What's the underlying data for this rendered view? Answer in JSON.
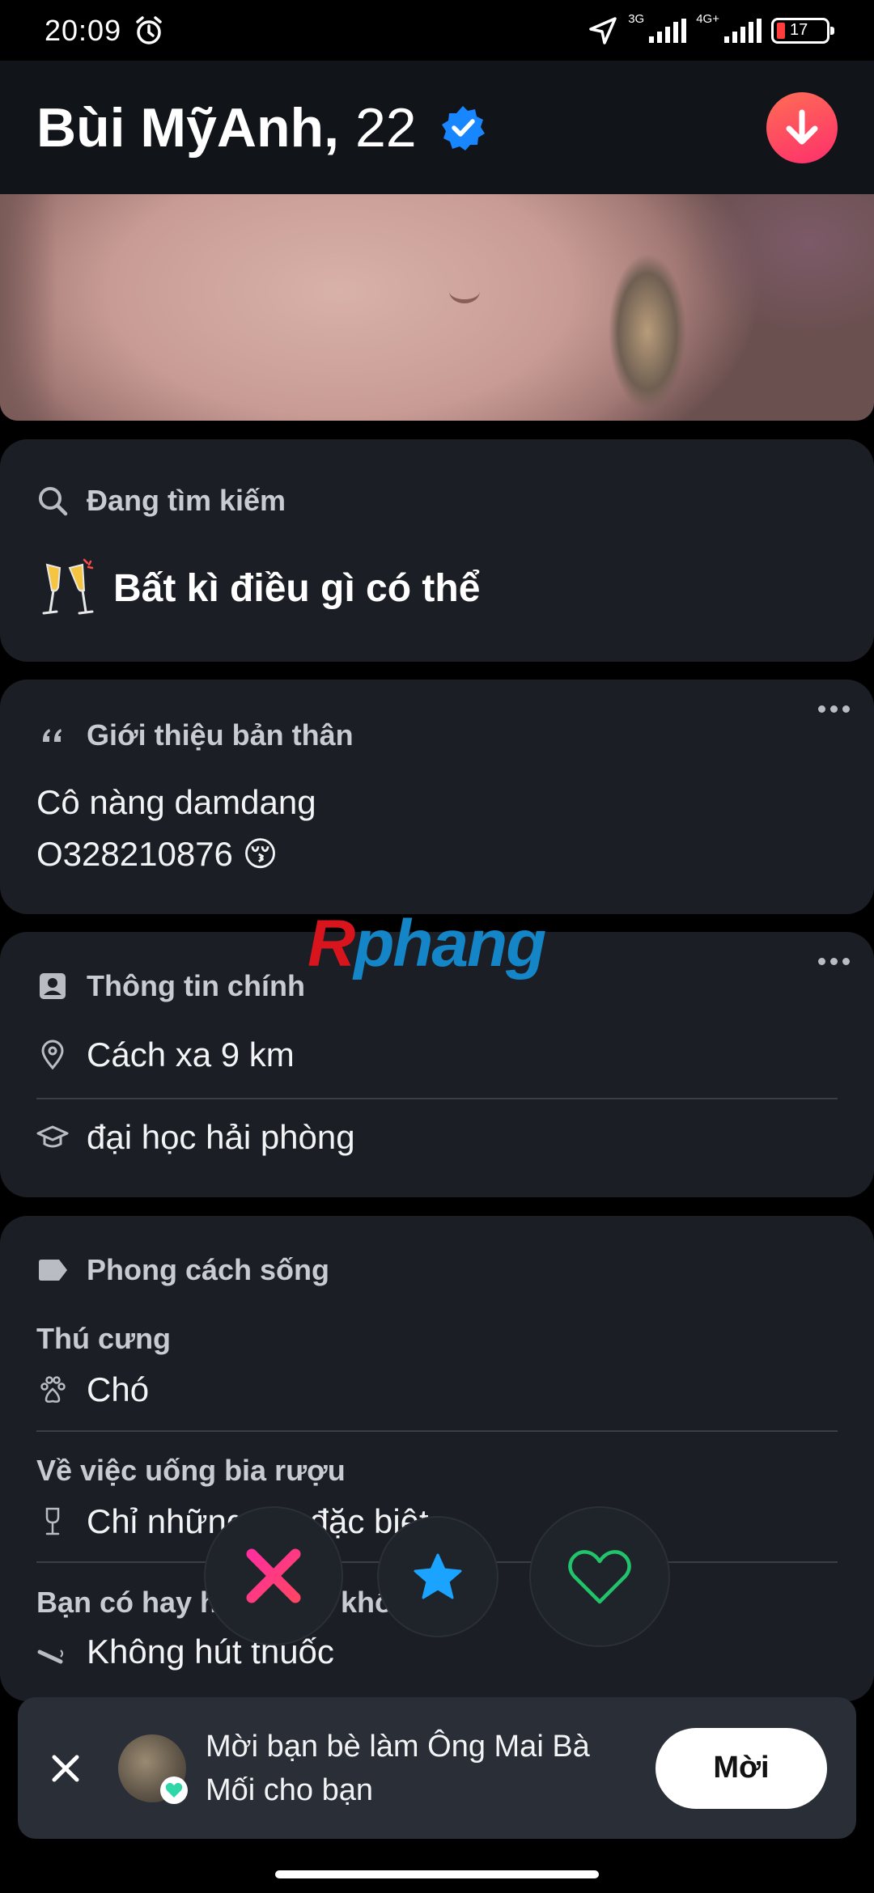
{
  "status_bar": {
    "time": "20:09",
    "network_1": "3G",
    "network_2": "4G+",
    "battery": "17"
  },
  "profile": {
    "name": "Bùi MỹAnh,",
    "age": "22",
    "verified": true
  },
  "looking_for": {
    "title": "Đang tìm kiếm",
    "value": "Bất kì điều gì có thể"
  },
  "bio": {
    "title": "Giới thiệu bản thân",
    "line1": "Cô nàng damdang",
    "line2": "O328210876 😚"
  },
  "basics": {
    "title": "Thông tin chính",
    "distance": "Cách xa 9 km",
    "school": "đại học hải phòng"
  },
  "lifestyle": {
    "title": "Phong cách sống",
    "pets_label": "Thú cưng",
    "pets_value": "Chó",
    "drinking_label": "Về việc uống bia rượu",
    "drinking_value": "Chỉ những dịp đặc biệt",
    "smoking_label": "Bạn có hay hút thuốc không?",
    "smoking_value": "Không hút thuốc"
  },
  "watermark": {
    "part1": "R",
    "part2": "phang"
  },
  "invite": {
    "text": "Mời bạn bè làm Ông Mai Bà Mối cho bạn",
    "button": "Mời"
  },
  "colors": {
    "accent_red": "#fd2f6c",
    "super_like_blue": "#1aa3ff",
    "like_green": "#21c46b",
    "verified_blue": "#1786ff"
  }
}
